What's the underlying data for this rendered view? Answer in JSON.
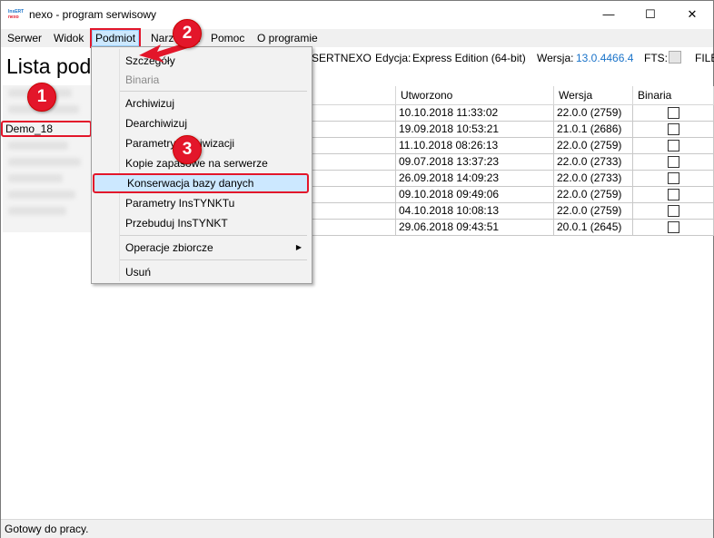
{
  "window": {
    "title": "nexo - program serwisowy",
    "logo_top": "InsERT",
    "logo_bottom": "nexo",
    "minimize": "—",
    "maximize": "☐",
    "close": "✕"
  },
  "menu": {
    "items": [
      "Serwer",
      "Widok",
      "Podmiot",
      "Narzędzia",
      "Pomoc",
      "O programie"
    ],
    "active": "Podmiot"
  },
  "info": {
    "page_title": "Lista pod",
    "server": "SERTNEXO",
    "edition_label": "Edycja:",
    "edition_value": "Express Edition (64-bit)",
    "version_label": "Wersja:",
    "version_value": "13.0.4466.4",
    "fts_label": "FTS:",
    "file_label": "FILE"
  },
  "sidebar": {
    "selected": "Demo_18"
  },
  "grid": {
    "columns": [
      "Utworzono",
      "Wersja",
      "Binaria"
    ],
    "rows": [
      {
        "created": "10.10.2018 11:33:02",
        "version": "22.0.0 (2759)",
        "binaria": false
      },
      {
        "created": "19.09.2018 10:53:21",
        "version": "21.0.1 (2686)",
        "binaria": false
      },
      {
        "created": "11.10.2018 08:26:13",
        "version": "22.0.0 (2759)",
        "binaria": false
      },
      {
        "created": "09.07.2018 13:37:23",
        "version": "22.0.0 (2733)",
        "binaria": false
      },
      {
        "created": "26.09.2018 14:09:23",
        "version": "22.0.0 (2733)",
        "binaria": false
      },
      {
        "created": "09.10.2018 09:49:06",
        "version": "22.0.0 (2759)",
        "binaria": false
      },
      {
        "created": "04.10.2018 10:08:13",
        "version": "22.0.0 (2759)",
        "binaria": false
      },
      {
        "created": "29.06.2018 09:43:51",
        "version": "20.0.1 (2645)",
        "binaria": false
      }
    ]
  },
  "dropdown": {
    "items": {
      "szczegoly": "Szczegóły",
      "binaria": "Binaria",
      "archiwizuj": "Archiwizuj",
      "dearchiwizuj": "Dearchiwizuj",
      "parametry_arch": "Parametry archiwizacji",
      "kopie": "Kopie zapasowe na serwerze",
      "konserwacja": "Konserwacja bazy danych",
      "instynkt": "Parametry InsTYNKTu",
      "przebuduj": "Przebuduj InsTYNKT",
      "operacje": "Operacje zbiorcze",
      "usun": "Usuń"
    }
  },
  "badges": [
    "1",
    "2",
    "3"
  ],
  "status": {
    "text": "Gotowy do pracy."
  },
  "colors": {
    "accent_red": "#e3162a",
    "menu_highlight": "#cce8ff",
    "version_blue": "#1a73c9"
  }
}
